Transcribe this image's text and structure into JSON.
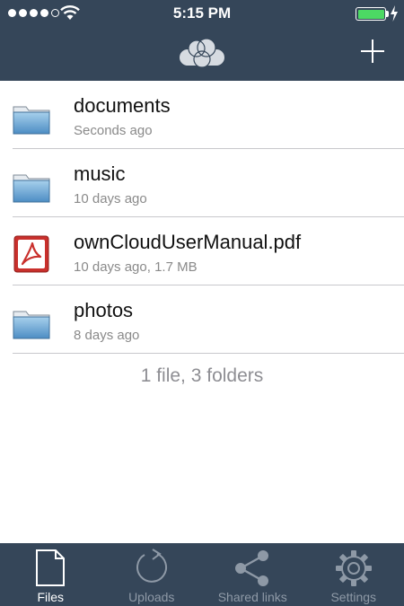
{
  "status_bar": {
    "time": "5:15 PM",
    "signal_bars": 4,
    "signal_total": 5,
    "battery_percent": 100,
    "charging": true,
    "icons": [
      "signal-dots-icon",
      "wifi-icon",
      "battery-icon",
      "charging-bolt-icon"
    ]
  },
  "nav": {
    "logo_icon": "owncloud-logo-icon",
    "add_icon": "plus-icon"
  },
  "files": [
    {
      "name": "documents",
      "meta": "Seconds ago",
      "icon": "folder-icon"
    },
    {
      "name": "music",
      "meta": "10 days ago",
      "icon": "folder-icon"
    },
    {
      "name": "ownCloudUserManual.pdf",
      "meta": "10 days ago, 1.7 MB",
      "icon": "pdf-file-icon"
    },
    {
      "name": "photos",
      "meta": "8 days ago",
      "icon": "folder-icon"
    }
  ],
  "summary": "1 file, 3 folders",
  "tabs": [
    {
      "label": "Files",
      "icon": "file-icon",
      "active": true
    },
    {
      "label": "Uploads",
      "icon": "refresh-icon",
      "active": false
    },
    {
      "label": "Shared links",
      "icon": "share-icon",
      "active": false
    },
    {
      "label": "Settings",
      "icon": "gear-icon",
      "active": false
    }
  ],
  "colors": {
    "bar_background": "#354659",
    "battery_fill": "#4cd964",
    "tab_inactive": "#8e99a6",
    "tab_active": "#ffffff",
    "meta_text": "#8a8a8a"
  }
}
